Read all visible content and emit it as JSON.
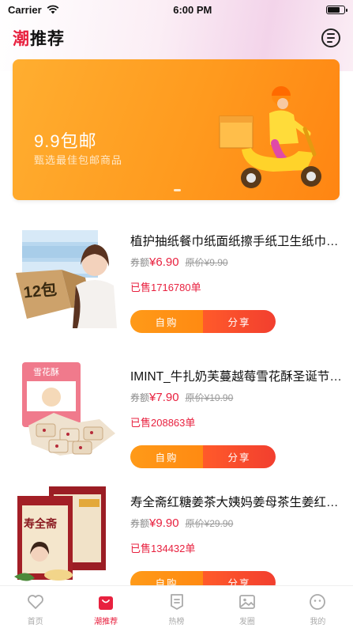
{
  "statusbar": {
    "carrier": "Carrier",
    "time": "6:00 PM",
    "battery_level": 0.85
  },
  "header": {
    "title_accent": "潮",
    "title_rest": "推荐",
    "menu_icon": "message-list-icon"
  },
  "banner": {
    "title": "9.9包邮",
    "subtitle": "甄选最佳包邮商品",
    "image_icon": "delivery-scooter-icon"
  },
  "product_labels": {
    "coupon": "券额",
    "original": "原价",
    "self_buy": "自购",
    "share": "分享"
  },
  "products": [
    {
      "title": "植护抽纸餐巾纸面纸擦手纸卫生纸巾家用",
      "price": "¥6.90",
      "original_price": "¥9.90",
      "sold": "已售1716780单",
      "image_icon": "tissue-box-product-icon",
      "badge": "12包"
    },
    {
      "title": "IMINT_牛扎奶芙蔓越莓雪花酥圣诞节零食",
      "price": "¥7.90",
      "original_price": "¥10.90",
      "sold": "已售208863单",
      "image_icon": "snowflake-pastry-product-icon",
      "badge": "雪花酥"
    },
    {
      "title": "寿全斋红糖姜茶大姨妈姜母茶生姜红枣茶",
      "price": "¥9.90",
      "original_price": "¥29.90",
      "sold": "已售134432单",
      "image_icon": "ginger-tea-product-icon",
      "badge": "寿全斋"
    }
  ],
  "tabs": [
    {
      "label": "首页",
      "icon": "heart-icon",
      "active": false
    },
    {
      "label": "潮推荐",
      "icon": "shopping-bag-icon",
      "active": true
    },
    {
      "label": "热榜",
      "icon": "ranking-list-icon",
      "active": false
    },
    {
      "label": "发圈",
      "icon": "picture-icon",
      "active": false
    },
    {
      "label": "我的",
      "icon": "smiley-face-icon",
      "active": false
    }
  ],
  "colors": {
    "accent": "#e8213f",
    "banner": "#ff9a1e",
    "self_buy": "#ff9a18",
    "share": "#f23f2f"
  }
}
